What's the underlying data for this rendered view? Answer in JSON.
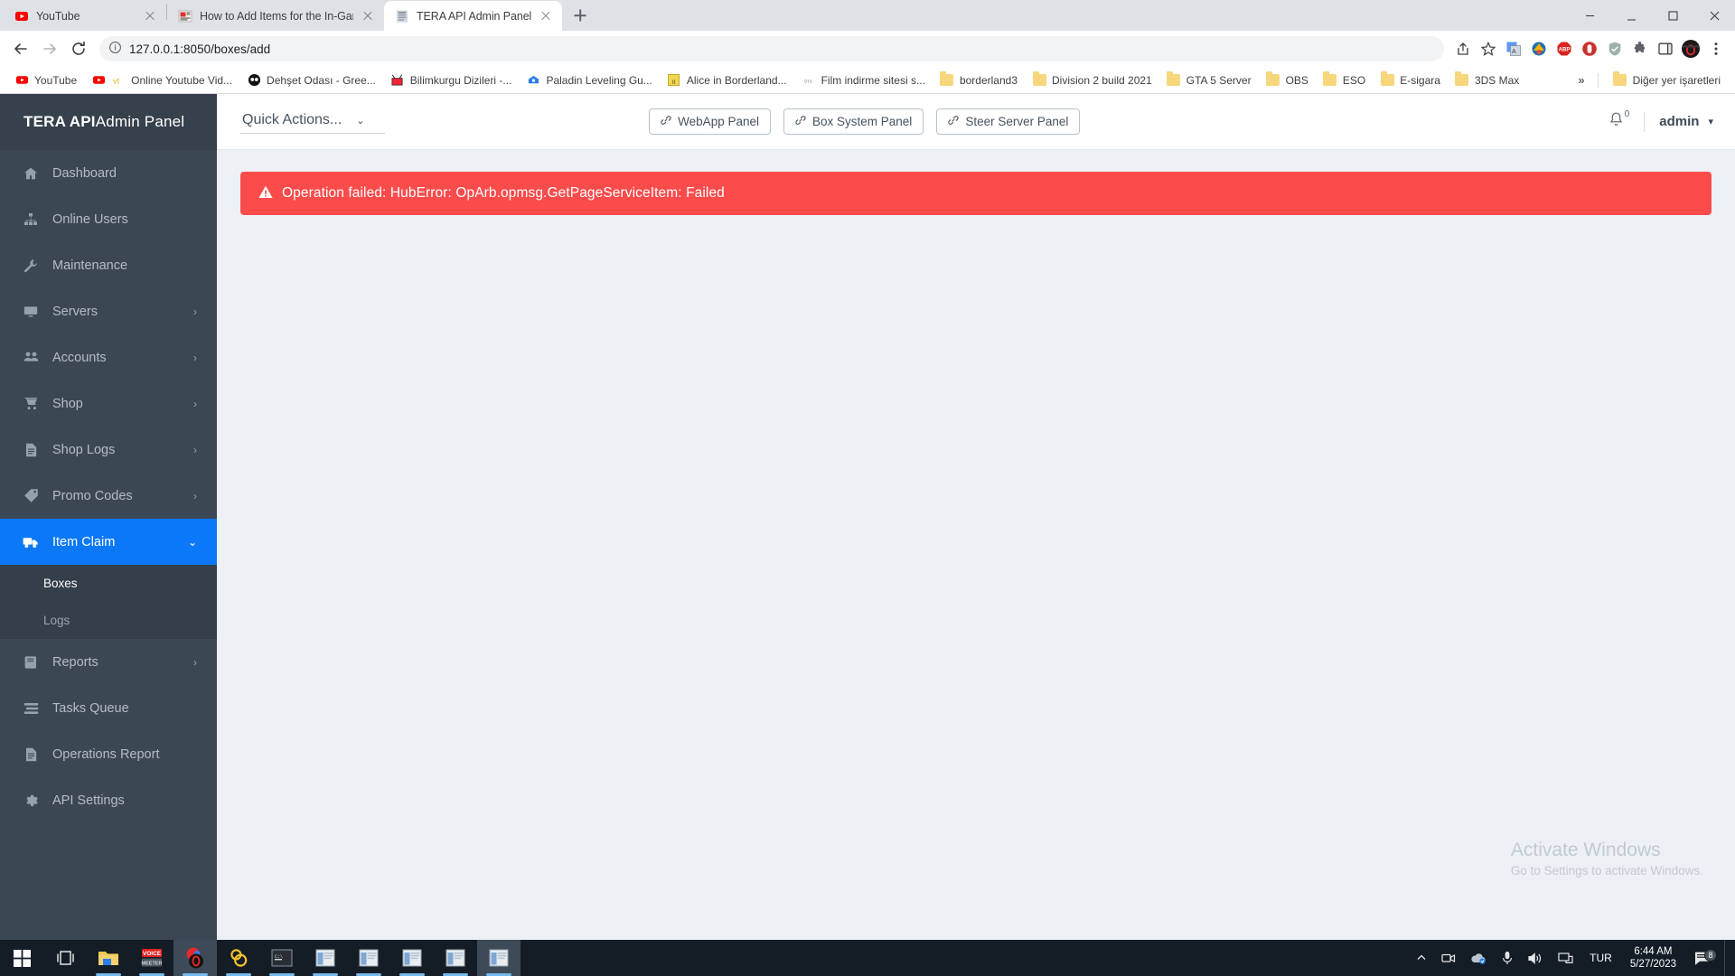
{
  "browser": {
    "tabs": [
      {
        "title": "YouTube",
        "favicon": "youtube-icon",
        "active": false
      },
      {
        "title": "How to Add Items for the In-Gam",
        "favicon": "article-icon",
        "active": false
      },
      {
        "title": "TERA API Admin Panel",
        "favicon": "tera-icon",
        "active": true
      }
    ],
    "new_tab_label": "+",
    "window_controls": {
      "minimize": "minimize-icon",
      "maximize": "maximize-icon",
      "close": "close-icon",
      "profile": "profile-icon"
    },
    "address": {
      "security_icon": "info-circle-icon",
      "url_full": "127.0.0.1:8050/boxes/add",
      "host": "127.0.0.1",
      "port": ":8050",
      "path": "/boxes/add"
    },
    "nav_icons": {
      "back": "back-arrow-icon",
      "forward": "forward-arrow-icon",
      "reload": "reload-icon",
      "share": "share-icon",
      "bookmark": "star-icon",
      "menu": "three-dot-menu-icon"
    },
    "extensions": [
      "translate-extension-icon",
      "download-extension-icon",
      "abp-extension-icon",
      "ublock-extension-icon",
      "shield-extension-icon",
      "puzzle-extensions-icon",
      "sidepanel-icon",
      "opera-profile-icon"
    ],
    "bookmarks": [
      {
        "label": "YouTube",
        "icon": "youtube-icon"
      },
      {
        "label": "Online Youtube Vid...",
        "icon": "site-icon"
      },
      {
        "label": "Dehşet Odası - Gree...",
        "icon": "site-icon"
      },
      {
        "label": "Bilimkurgu Dizileri -...",
        "icon": "site-icon"
      },
      {
        "label": "Paladin Leveling Gu...",
        "icon": "site-icon"
      },
      {
        "label": "Alice in Borderland...",
        "icon": "site-icon"
      },
      {
        "label": "Film indirme sitesi s...",
        "icon": "site-icon"
      },
      {
        "label": "borderland3",
        "icon": "folder-icon"
      },
      {
        "label": "Division 2 build 2021",
        "icon": "folder-icon"
      },
      {
        "label": "GTA 5 Server",
        "icon": "folder-icon"
      },
      {
        "label": "OBS",
        "icon": "folder-icon"
      },
      {
        "label": "ESO",
        "icon": "folder-icon"
      },
      {
        "label": "E-sigara",
        "icon": "folder-icon"
      },
      {
        "label": "3DS Max",
        "icon": "folder-icon"
      }
    ],
    "bookmarks_overflow": "»",
    "other_bookmarks": {
      "label": "Diğer yer işaretleri",
      "icon": "folder-icon"
    }
  },
  "app": {
    "brand": {
      "bold": "TERA API",
      "light": " Admin Panel"
    },
    "sidebar": {
      "items": [
        {
          "label": "Dashboard",
          "icon": "home-icon",
          "expandable": false,
          "active": false
        },
        {
          "label": "Online Users",
          "icon": "sitemap-icon",
          "expandable": false,
          "active": false
        },
        {
          "label": "Maintenance",
          "icon": "wrench-icon",
          "expandable": false,
          "active": false
        },
        {
          "label": "Servers",
          "icon": "monitor-icon",
          "expandable": true,
          "active": false
        },
        {
          "label": "Accounts",
          "icon": "users-icon",
          "expandable": true,
          "active": false
        },
        {
          "label": "Shop",
          "icon": "cart-icon",
          "expandable": true,
          "active": false
        },
        {
          "label": "Shop Logs",
          "icon": "file-text-icon",
          "expandable": true,
          "active": false
        },
        {
          "label": "Promo Codes",
          "icon": "tag-icon",
          "expandable": true,
          "active": false
        },
        {
          "label": "Item Claim",
          "icon": "truck-icon",
          "expandable": true,
          "active": true
        },
        {
          "label": "Reports",
          "icon": "book-icon",
          "expandable": true,
          "active": false
        },
        {
          "label": "Tasks Queue",
          "icon": "stream-icon",
          "expandable": false,
          "active": false
        },
        {
          "label": "Operations Report",
          "icon": "file-text-icon",
          "expandable": false,
          "active": false
        },
        {
          "label": "API Settings",
          "icon": "gear-icon",
          "expandable": false,
          "active": false
        }
      ],
      "submenu": {
        "parent": "Item Claim",
        "items": [
          {
            "label": "Boxes",
            "current": true
          },
          {
            "label": "Logs",
            "current": false
          }
        ]
      },
      "chevron_collapsed": "›",
      "chevron_expanded": "⌄"
    },
    "topbar": {
      "quick_actions_label": "Quick Actions...",
      "quick_actions_caret": "⌄",
      "panel_buttons": [
        {
          "label": "WebApp Panel",
          "icon": "link-icon"
        },
        {
          "label": "Box System Panel",
          "icon": "link-icon"
        },
        {
          "label": "Steer Server Panel",
          "icon": "link-icon"
        }
      ],
      "notifications": {
        "icon": "bell-icon",
        "count": "0"
      },
      "user": {
        "name": "admin",
        "caret": "▾"
      }
    },
    "alert": {
      "icon": "warning-triangle-icon",
      "message": "Operation failed: HubError: OpArb.opmsg.GetPageServiceItem: Failed",
      "color": "#fc4b4b"
    },
    "watermark": {
      "line1": "Activate Windows",
      "line2": "Go to Settings to activate Windows."
    },
    "accent_color": "#0b79f7",
    "sidebar_color": "#3b4854"
  },
  "taskbar": {
    "start": "windows-start-icon",
    "items": [
      {
        "icon": "task-view-icon",
        "running": false,
        "active": false
      },
      {
        "icon": "file-explorer-icon",
        "running": true,
        "active": false
      },
      {
        "icon": "voicemeeter-icon",
        "running": true,
        "active": false
      },
      {
        "icon": "opera-icon",
        "running": true,
        "active": false
      },
      {
        "icon": "chrome-icon",
        "running": true,
        "active": false
      },
      {
        "icon": "terminal-icon",
        "running": true,
        "active": false
      },
      {
        "icon": "window-app-icon",
        "running": true,
        "active": false
      },
      {
        "icon": "window-app-icon",
        "running": true,
        "active": false
      },
      {
        "icon": "window-app-icon",
        "running": true,
        "active": false
      },
      {
        "icon": "window-app-icon",
        "running": true,
        "active": false
      },
      {
        "icon": "window-app-icon",
        "running": true,
        "active": true
      }
    ],
    "tray": {
      "overflow": "show-hidden-icons-chevron",
      "icons": [
        "screen-record-icon",
        "onedrive-icon",
        "microphone-icon",
        "volume-icon",
        "display-icon"
      ],
      "language": "TUR",
      "time": "6:44 AM",
      "date": "5/27/2023",
      "action_center": {
        "icon": "action-center-icon",
        "badge": "8"
      }
    }
  }
}
